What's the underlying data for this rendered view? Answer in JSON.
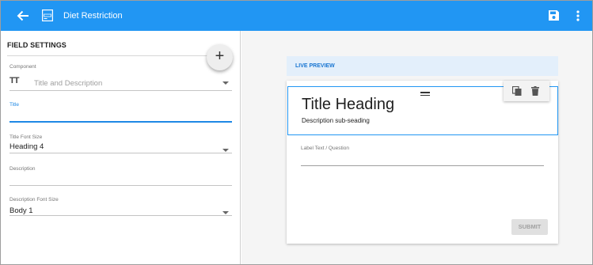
{
  "header": {
    "title": "Diet Restriction",
    "form_icon_text": "TEXT"
  },
  "field_settings": {
    "title": "FIELD SETTINGS",
    "add_button_label": "+",
    "component": {
      "label": "Component",
      "value": "Title and Description"
    },
    "title_field": {
      "label": "Title",
      "value": ""
    },
    "title_font_size": {
      "label": "Title Font Size",
      "value": "Heading 4"
    },
    "description": {
      "label": "Description",
      "value": ""
    },
    "description_font_size": {
      "label": "Description Font Size",
      "value": "Body 1"
    }
  },
  "preview": {
    "header": "LIVE PREVIEW",
    "heading": "Title Heading",
    "subheading": "Description sub-seading",
    "question_label": "Label Text / Question",
    "submit_label": "SUBMIT"
  },
  "colors": {
    "primary": "#2196f3",
    "live_preview_bg": "#e3effb",
    "panel_bg": "#f5f5f5"
  },
  "icons": [
    "arrow-back-icon",
    "form-icon",
    "save-icon",
    "more-vert-icon",
    "add-icon",
    "text-fields-icon",
    "chevron-down-icon",
    "drag-handle-icon",
    "copy-icon",
    "delete-icon"
  ]
}
